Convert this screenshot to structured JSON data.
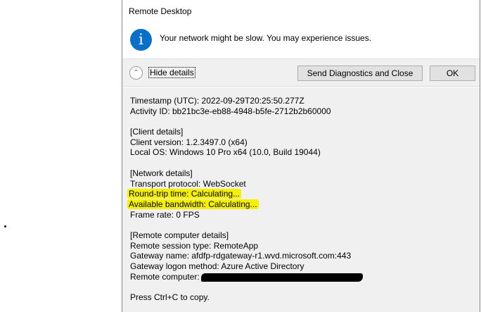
{
  "dialog": {
    "title": "Remote Desktop",
    "message": "Your network might be slow. You may experience issues.",
    "info_icon": "i",
    "hide_details": "Hide details",
    "send_button": "Send Diagnostics and Close",
    "ok_button": "OK",
    "details": {
      "timestamp": "Timestamp (UTC): 2022-09-29T20:25:50.277Z",
      "activity": "Activity ID: bb21bc3e-eb88-4948-b5fe-2712b2b60000",
      "client_header": "[Client details]",
      "client_version": "Client version: 1.2.3497.0 (x64)",
      "local_os": "Local OS: Windows 10 Pro x64 (10.0, Build 19044)",
      "network_header": "[Network details]",
      "transport": "Transport protocol: WebSocket",
      "rtt": "Round-trip time: Calculating...",
      "bandwidth": "Available bandwidth: Calculating...",
      "frame_rate": "Frame rate: 0 FPS",
      "remote_header": "[Remote computer details]",
      "session_type": "Remote session type: RemoteApp",
      "gateway": "Gateway name: afdfp-rdgateway-r1.wvd.microsoft.com:443",
      "logon": "Gateway logon method: Azure Active Directory",
      "remote_computer": "Remote computer:",
      "copy_hint": "Press Ctrl+C to copy."
    }
  },
  "colors": {
    "highlight": "#f5f000",
    "info": "#0a6fc9"
  }
}
